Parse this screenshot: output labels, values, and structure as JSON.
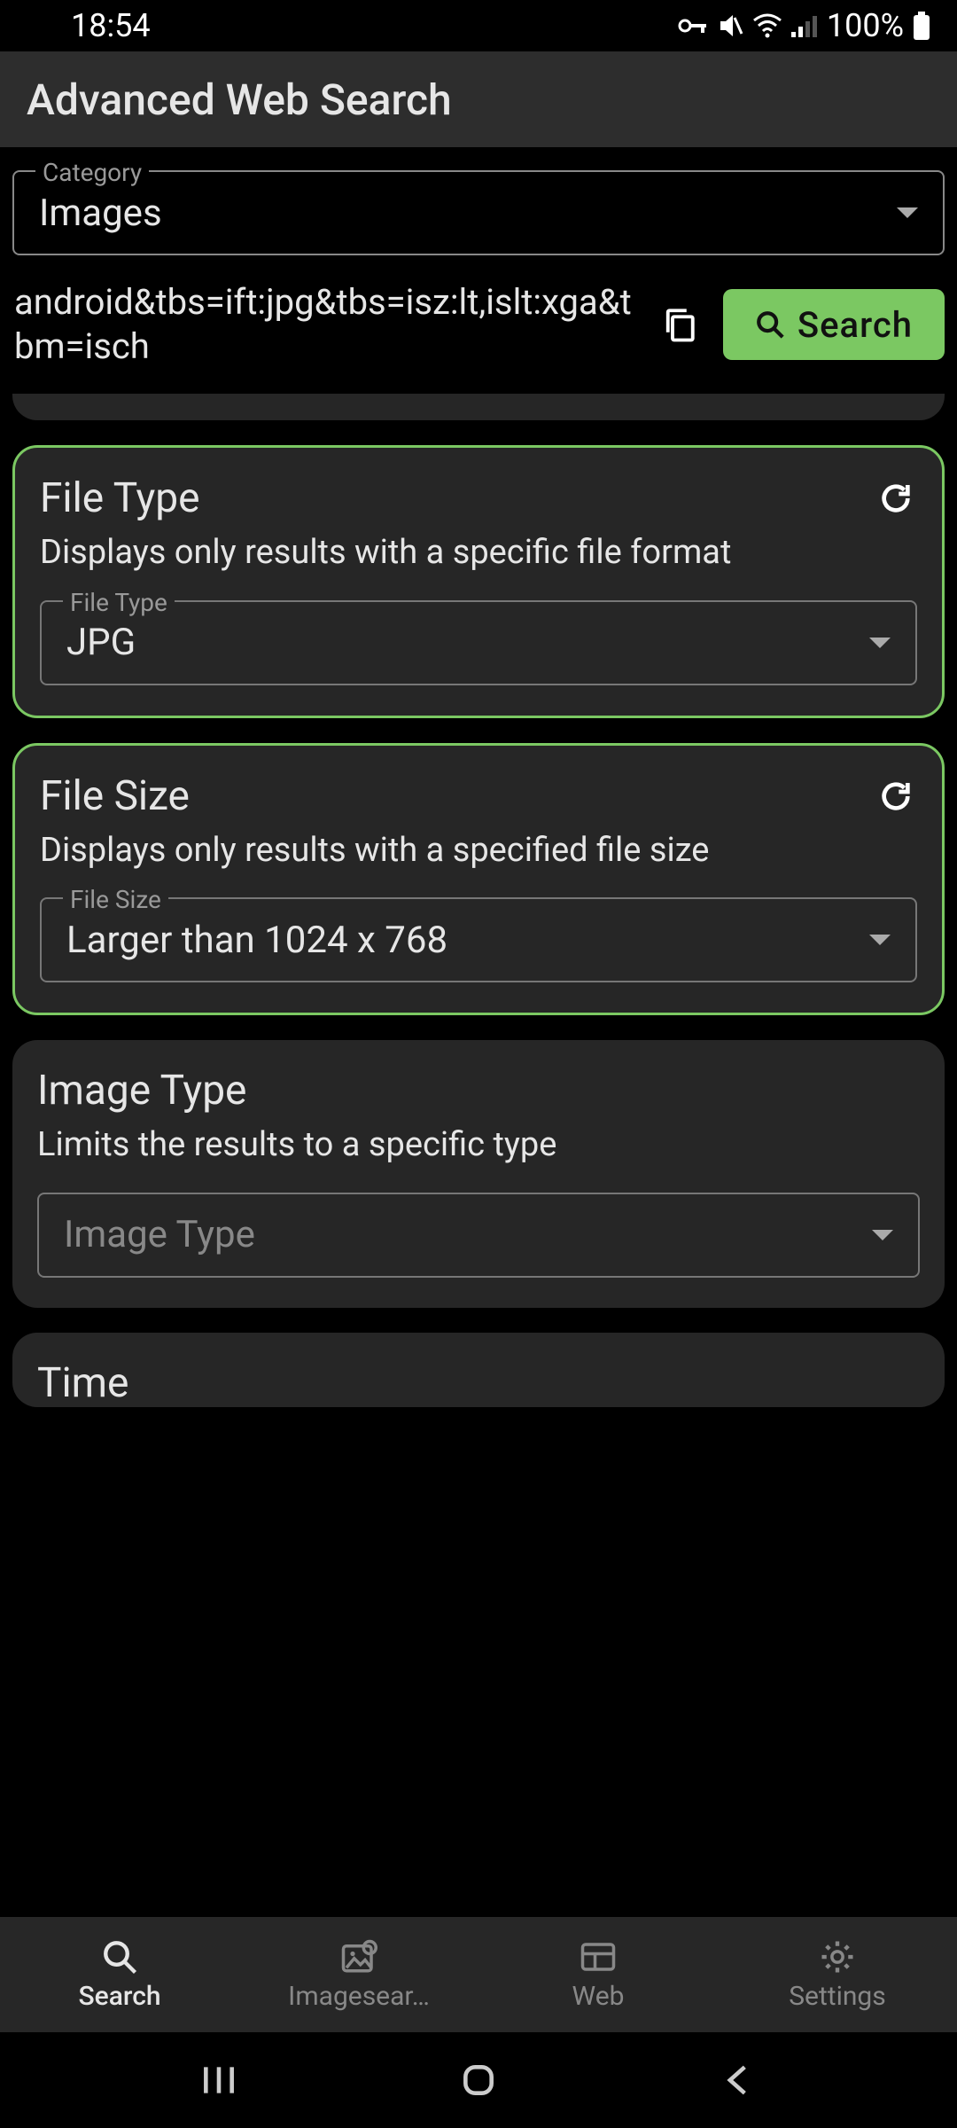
{
  "status": {
    "time": "18:54",
    "battery": "100%"
  },
  "header": {
    "title": "Advanced Web Search"
  },
  "category": {
    "label": "Category",
    "value": "Images"
  },
  "query": {
    "text": "android&tbs=ift:jpg&tbs=isz:lt,islt:xga&tbm=isch",
    "search_label": "Search"
  },
  "cards": {
    "fileType": {
      "title": "File Type",
      "desc": "Displays only results with a specific file format",
      "selectLabel": "File Type",
      "value": "JPG"
    },
    "fileSize": {
      "title": "File Size",
      "desc": "Displays only results with a specified file size",
      "selectLabel": "File Size",
      "value": "Larger than 1024 x 768"
    },
    "imageType": {
      "title": "Image Type",
      "desc": "Limits the results to a specific type",
      "placeholder": "Image Type"
    },
    "time": {
      "title": "Time"
    }
  },
  "nav": {
    "search": "Search",
    "imagesearch": "Imagesear…",
    "web": "Web",
    "settings": "Settings"
  }
}
